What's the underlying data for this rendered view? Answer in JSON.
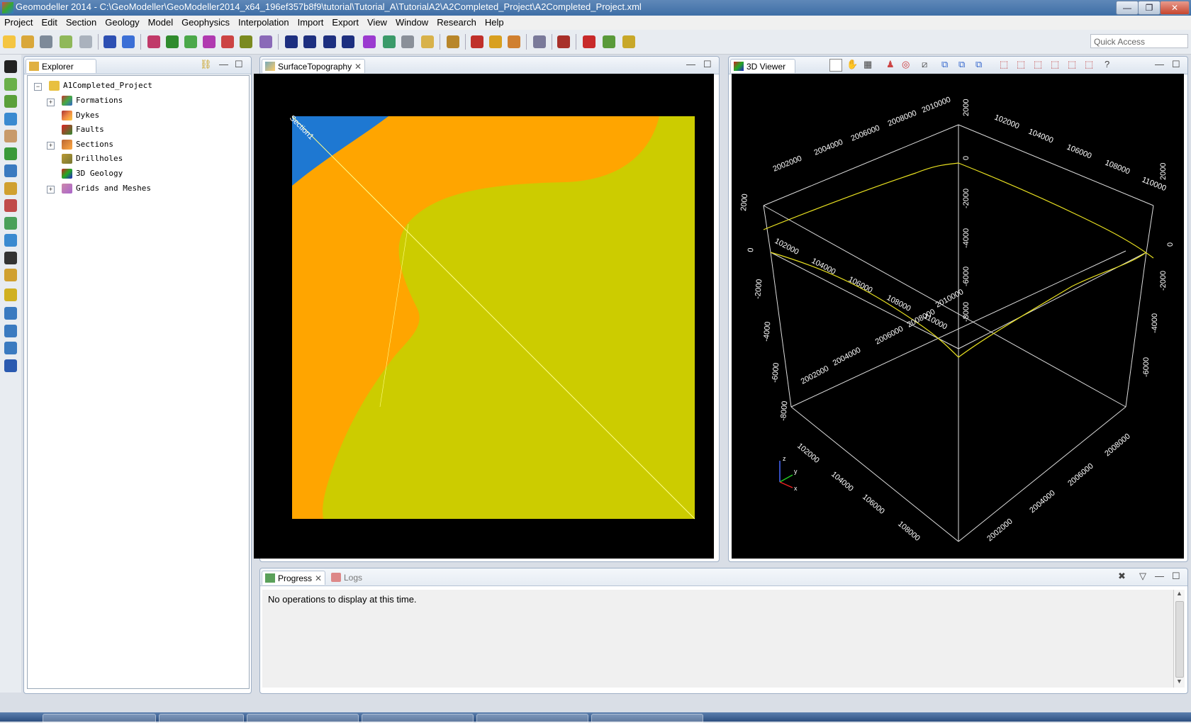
{
  "window": {
    "title": "Geomodeller 2014 - C:\\GeoModeller\\GeoModeller2014_x64_196ef357b8f9\\tutorial\\Tutorial_A\\TutorialA2\\A2Completed_Project\\A2Completed_Project.xml",
    "minimize": "—",
    "restore": "❐",
    "close": "✕"
  },
  "menu": [
    "Project",
    "Edit",
    "Section",
    "Geology",
    "Model",
    "Geophysics",
    "Interpolation",
    "Import",
    "Export",
    "View",
    "Window",
    "Research",
    "Help"
  ],
  "toolbar": {
    "quick_access_placeholder": "Quick Access"
  },
  "explorer": {
    "tab_label": "Explorer",
    "root": "A1Completed_Project",
    "items": [
      {
        "label": "Formations",
        "expandable": true,
        "icon": "formations-icon"
      },
      {
        "label": "Dykes",
        "expandable": false,
        "icon": "dykes-icon"
      },
      {
        "label": "Faults",
        "expandable": false,
        "icon": "faults-icon"
      },
      {
        "label": "Sections",
        "expandable": true,
        "icon": "sections-icon"
      },
      {
        "label": "Drillholes",
        "expandable": false,
        "icon": "drillholes-icon"
      },
      {
        "label": "3D Geology",
        "expandable": false,
        "icon": "geology-3d-icon"
      },
      {
        "label": "Grids and Meshes",
        "expandable": true,
        "icon": "grids-icon"
      }
    ]
  },
  "editor": {
    "tab_label": "SurfaceTopography",
    "section_label": "Section1",
    "colors": {
      "orange": "#ffa500",
      "olive": "#cccc00",
      "blue": "#1e78d2",
      "line": "#ffff88"
    }
  },
  "viewer": {
    "tab_label": "3D Viewer",
    "top_left_labels": [
      "2002000",
      "2004000",
      "2006000",
      "2008000",
      "2010000"
    ],
    "top_right_labels": [
      "102000",
      "104000",
      "106000",
      "108000",
      "110000"
    ],
    "left_depth_labels": [
      "2000",
      "0",
      "-2000",
      "-4000",
      "-6000",
      "-8000"
    ],
    "bottom_left_labels": [
      "102000",
      "104000",
      "106000",
      "108000"
    ],
    "bottom_right_labels": [
      "2002000",
      "2004000",
      "2006000",
      "2008000"
    ],
    "center_depth_labels": [
      "2000",
      "0",
      "-2000",
      "-4000",
      "-6000",
      "-8000"
    ],
    "mid_left_labels": [
      "2002000",
      "2004000",
      "2006000",
      "2008000",
      "2010000"
    ],
    "mid_right_labels": [
      "102000",
      "104000",
      "106000",
      "108000",
      "110000"
    ],
    "right_depth_labels": [
      "2000",
      "0",
      "-2000",
      "-4000",
      "-6000"
    ],
    "axis_letters": [
      "z",
      "y",
      "x"
    ]
  },
  "progress": {
    "tab_label": "Progress",
    "logs_tab_label": "Logs",
    "message": "No operations to display at this time."
  }
}
